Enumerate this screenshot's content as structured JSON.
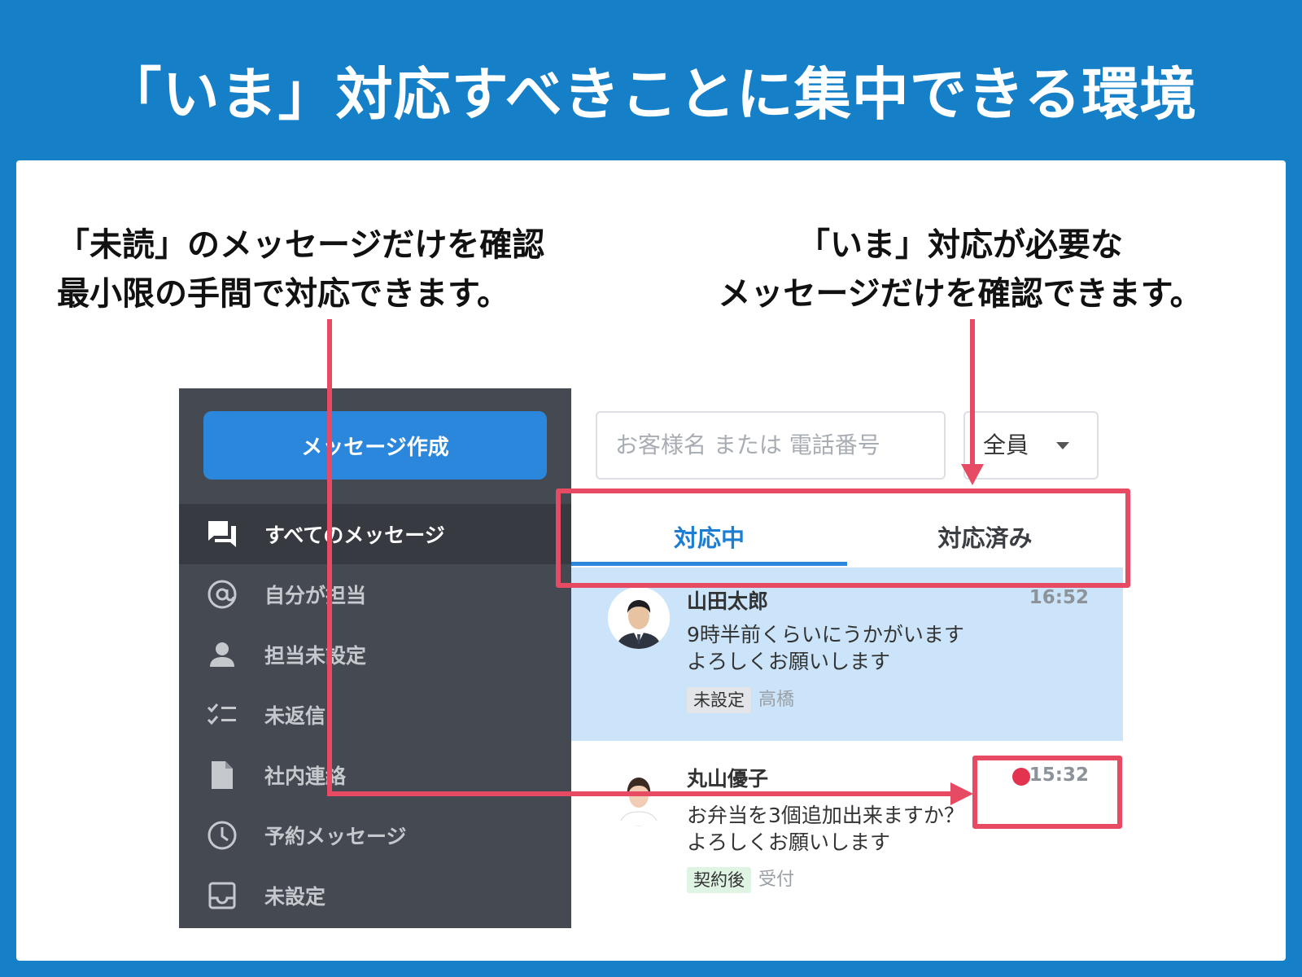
{
  "headline": "「いま」対応すべきことに集中できる環境",
  "captions": {
    "left_line1": "「未読」のメッセージだけを確認",
    "left_line2": "最小限の手間で対応できます。",
    "right_line1": "「いま」対応が必要な",
    "right_line2": "メッセージだけを確認できます。"
  },
  "sidebar": {
    "compose_label": "メッセージ作成",
    "items": [
      {
        "label": "すべてのメッセージ",
        "icon": "chat-bubbles-icon",
        "active": true
      },
      {
        "label": "自分が担当",
        "icon": "at-sign-icon",
        "active": false
      },
      {
        "label": "担当未設定",
        "icon": "person-icon",
        "active": false
      },
      {
        "label": "未返信",
        "icon": "checklist-icon",
        "active": false
      },
      {
        "label": "社内連絡",
        "icon": "document-icon",
        "active": false
      },
      {
        "label": "予約メッセージ",
        "icon": "clock-icon",
        "active": false
      },
      {
        "label": "未設定",
        "icon": "inbox-icon",
        "active": false
      }
    ]
  },
  "search": {
    "placeholder": "お客様名 または 電話番号",
    "filter_value": "全員"
  },
  "tabs": {
    "active": "対応中",
    "done": "対応済み"
  },
  "messages": [
    {
      "name": "山田太郎",
      "time": "16:52",
      "line1": "9時半前くらいにうかがいます",
      "line2": "よろしくお願いします",
      "tag": "未設定",
      "assignee": "高橋",
      "unread": false
    },
    {
      "name": "丸山優子",
      "time": "15:32",
      "line1": "お弁当を3個追加出来ますか？",
      "line2": "よろしくお願いします",
      "tag": "契約後",
      "assignee": "受付",
      "unread": true
    }
  ],
  "colors": {
    "background": "#1580c8",
    "accent": "#2b87db",
    "annotation": "#e74b63",
    "sidebar": "#454a52",
    "selected_message": "#cbe4f9",
    "tag_gray": "#e3e5e8",
    "tag_green": "#dff4e3"
  }
}
